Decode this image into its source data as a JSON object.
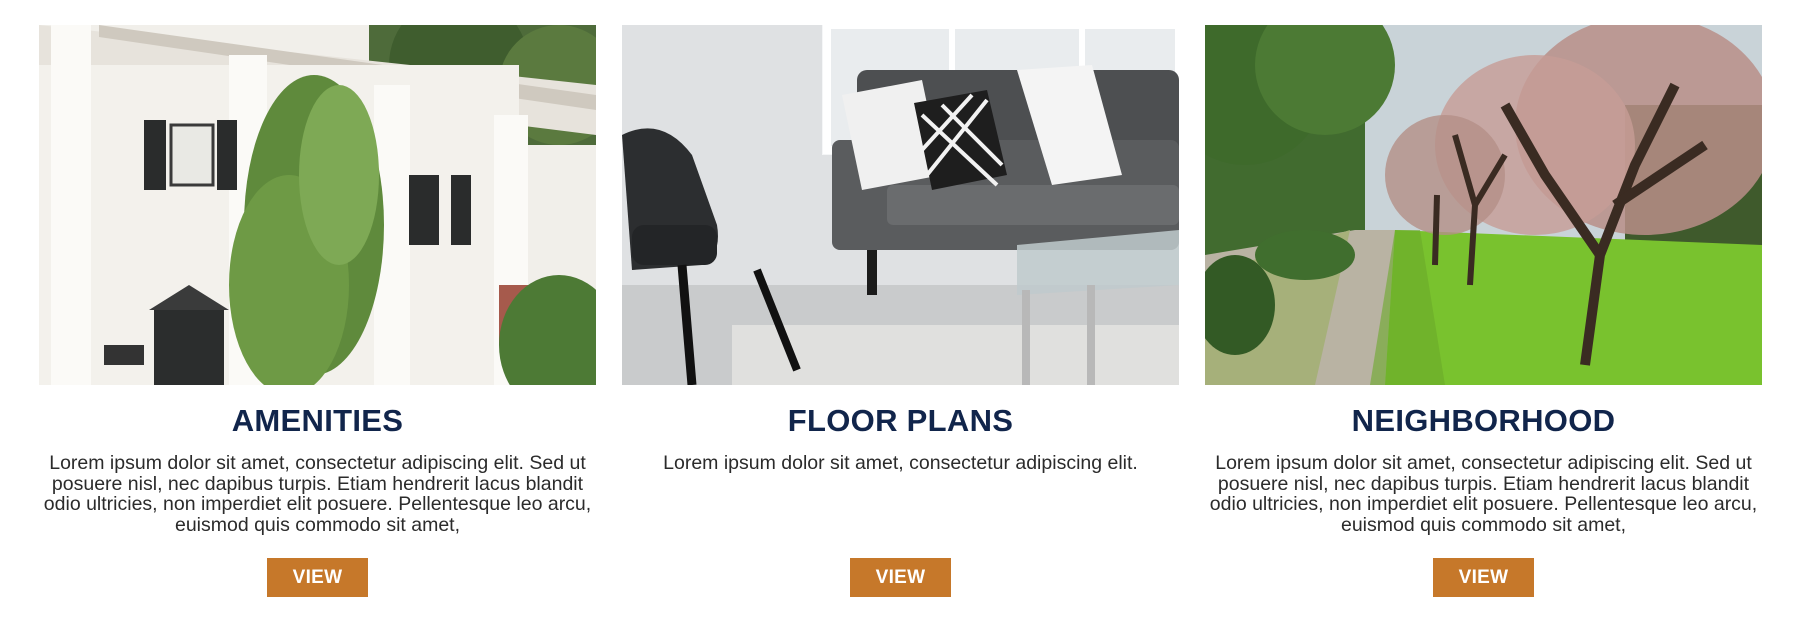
{
  "cards": [
    {
      "image": "building-photo",
      "title": "AMENITIES",
      "description": "Lorem ipsum dolor sit amet, consectetur adipiscing elit. Sed ut posuere nisl, nec dapibus turpis. Etiam hendrerit lacus blandit odio ultricies, non imperdiet elit posuere. Pellentesque leo arcu, euismod quis commodo sit amet,",
      "button_label": "VIEW"
    },
    {
      "image": "living-room-photo",
      "title": "FLOOR PLANS",
      "description": "Lorem ipsum dolor sit amet, consectetur adipiscing elit.",
      "button_label": "VIEW"
    },
    {
      "image": "tree-lined-path-photo",
      "title": "NEIGHBORHOOD",
      "description": "Lorem ipsum dolor sit amet, consectetur adipiscing elit. Sed ut posuere nisl, nec dapibus turpis. Etiam hendrerit lacus blandit odio ultricies, non imperdiet elit posuere. Pellentesque leo arcu, euismod quis commodo sit amet,",
      "button_label": "VIEW"
    }
  ],
  "colors": {
    "title": "#11254b",
    "button": "#c6782a",
    "button_text": "#ffffff",
    "body_text": "#2b2b2b"
  }
}
